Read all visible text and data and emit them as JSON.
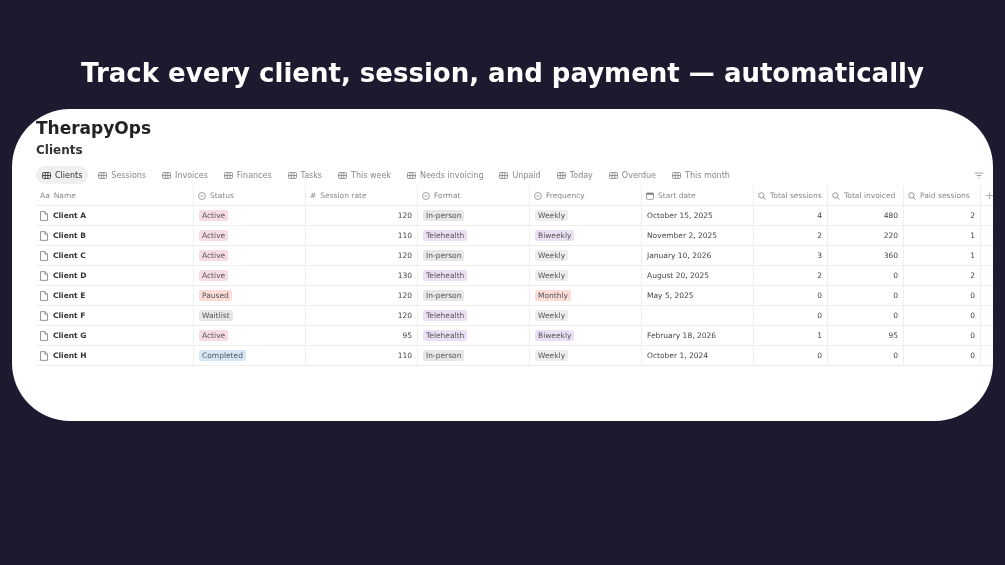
{
  "headline": "Track every client, session, and payment — automatically",
  "workspace": {
    "title": "TherapyOps",
    "database_title": "Clients"
  },
  "tabs": [
    {
      "label": "Clients",
      "selected": true
    },
    {
      "label": "Sessions",
      "selected": false
    },
    {
      "label": "Invoices",
      "selected": false
    },
    {
      "label": "Finances",
      "selected": false
    },
    {
      "label": "Tasks",
      "selected": false
    },
    {
      "label": "This week",
      "selected": false
    },
    {
      "label": "Needs invoicing",
      "selected": false
    },
    {
      "label": "Unpaid",
      "selected": false
    },
    {
      "label": "Today",
      "selected": false
    },
    {
      "label": "Overdue",
      "selected": false
    },
    {
      "label": "This month",
      "selected": false
    }
  ],
  "table": {
    "columns": [
      {
        "label": "Name",
        "kind": "title",
        "glyph": "Aa"
      },
      {
        "label": "Status",
        "kind": "select"
      },
      {
        "label": "Session rate",
        "kind": "number",
        "glyph": "#"
      },
      {
        "label": "Format",
        "kind": "select"
      },
      {
        "label": "Frequency",
        "kind": "select"
      },
      {
        "label": "Start date",
        "kind": "date"
      },
      {
        "label": "Total sessions",
        "kind": "rollup"
      },
      {
        "label": "Total invoiced",
        "kind": "rollup"
      },
      {
        "label": "Paid sessions",
        "kind": "rollup"
      }
    ],
    "add_column": "+",
    "rows": [
      {
        "name": "Client A",
        "status": {
          "label": "Active",
          "color": "#f6dce7"
        },
        "rate": "120",
        "format": {
          "label": "In-person",
          "color": "#e8e7e5"
        },
        "frequency": {
          "label": "Weekly",
          "color": "#eeedeb"
        },
        "start_date": "October 15, 2025",
        "total_sessions": "4",
        "total_invoiced": "480",
        "paid_sessions": "2"
      },
      {
        "name": "Client B",
        "status": {
          "label": "Active",
          "color": "#f6dce7"
        },
        "rate": "110",
        "format": {
          "label": "Telehealth",
          "color": "#ebdff5"
        },
        "frequency": {
          "label": "Biweekly",
          "color": "#ebdff5"
        },
        "start_date": "November 2, 2025",
        "total_sessions": "2",
        "total_invoiced": "220",
        "paid_sessions": "1"
      },
      {
        "name": "Client C",
        "status": {
          "label": "Active",
          "color": "#f6dce7"
        },
        "rate": "120",
        "format": {
          "label": "In-person",
          "color": "#e8e7e5"
        },
        "frequency": {
          "label": "Weekly",
          "color": "#eeedeb"
        },
        "start_date": "January 10, 2026",
        "total_sessions": "3",
        "total_invoiced": "360",
        "paid_sessions": "1"
      },
      {
        "name": "Client D",
        "status": {
          "label": "Active",
          "color": "#f6dce7"
        },
        "rate": "130",
        "format": {
          "label": "Telehealth",
          "color": "#ebdff5"
        },
        "frequency": {
          "label": "Weekly",
          "color": "#eeedeb"
        },
        "start_date": "August 20, 2025",
        "total_sessions": "2",
        "total_invoiced": "0",
        "paid_sessions": "2"
      },
      {
        "name": "Client E",
        "status": {
          "label": "Paused",
          "color": "#fbdcd7"
        },
        "rate": "120",
        "format": {
          "label": "In-person",
          "color": "#e8e7e5"
        },
        "frequency": {
          "label": "Monthly",
          "color": "#fbdcd7"
        },
        "start_date": "May 5, 2025",
        "total_sessions": "0",
        "total_invoiced": "0",
        "paid_sessions": "0"
      },
      {
        "name": "Client F",
        "status": {
          "label": "Waitlist",
          "color": "#e8e7e5"
        },
        "rate": "120",
        "format": {
          "label": "Telehealth",
          "color": "#ebdff5"
        },
        "frequency": {
          "label": "Weekly",
          "color": "#eeedeb"
        },
        "total_sessions": "0",
        "total_invoiced": "0",
        "paid_sessions": "0"
      },
      {
        "name": "Client G",
        "status": {
          "label": "Active",
          "color": "#f6dce7"
        },
        "rate": "95",
        "format": {
          "label": "Telehealth",
          "color": "#ebdff5"
        },
        "frequency": {
          "label": "Biweekly",
          "color": "#ebdff5"
        },
        "start_date": "February 18, 2026",
        "total_sessions": "1",
        "total_invoiced": "95",
        "paid_sessions": "0"
      },
      {
        "name": "Client H",
        "status": {
          "label": "Completed",
          "color": "#d5e7f7"
        },
        "rate": "110",
        "format": {
          "label": "In-person",
          "color": "#e8e7e5"
        },
        "frequency": {
          "label": "Weekly",
          "color": "#eeedeb"
        },
        "start_date": "October 1, 2024",
        "total_sessions": "0",
        "total_invoiced": "0",
        "paid_sessions": "0"
      }
    ]
  }
}
